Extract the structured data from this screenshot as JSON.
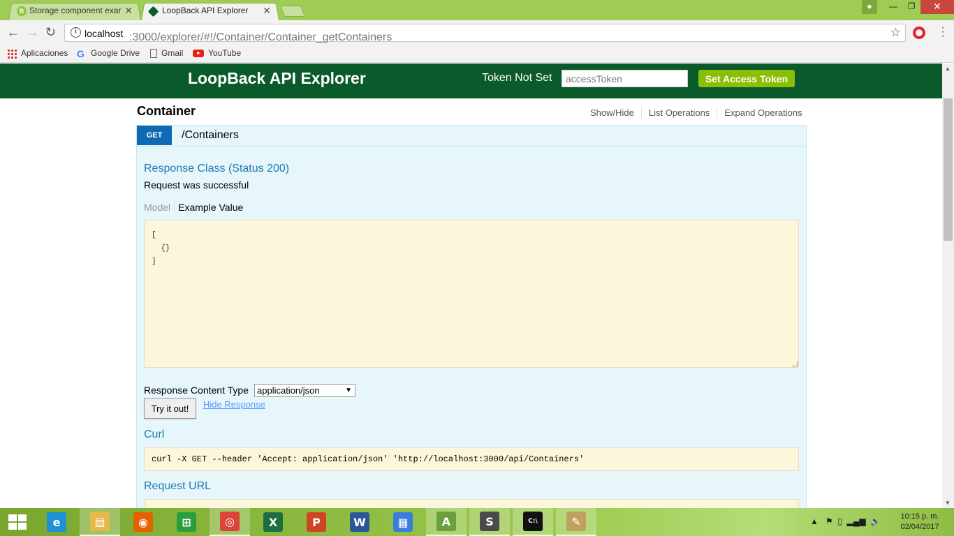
{
  "browser": {
    "tabs": [
      {
        "label": "Storage component exar",
        "icon": "bootstrap-icon",
        "active": false
      },
      {
        "label": "LoopBack API Explorer",
        "icon": "loopback-icon",
        "active": true
      }
    ],
    "url_host": "localhost",
    "url_path": ":3000/explorer/#!/Container/Container_getContainers",
    "bookmarks": [
      {
        "label": "Aplicaciones",
        "icon": "apps-grid-icon"
      },
      {
        "label": "Google Drive",
        "icon": "google-icon"
      },
      {
        "label": "Gmail",
        "icon": "page-icon"
      },
      {
        "label": "YouTube",
        "icon": "youtube-icon"
      }
    ]
  },
  "header": {
    "title": "LoopBack API Explorer",
    "token_status": "Token Not Set",
    "token_placeholder": "accessToken",
    "set_token_label": "Set Access Token"
  },
  "resource": {
    "title": "Container",
    "links": [
      "Show/Hide",
      "List Operations",
      "Expand Operations"
    ]
  },
  "operation": {
    "method": "GET",
    "path": "/Containers",
    "response_class_title": "Response Class (Status 200)",
    "response_message": "Request was successful",
    "model_tab": "Model",
    "example_tab": "Example Value",
    "example_value": "[\n  {}\n]",
    "content_type_label": "Response Content Type",
    "content_type_value": "application/json",
    "try_label": "Try it out!",
    "hide_response_label": "Hide Response",
    "curl_title": "Curl",
    "curl_command": "curl -X GET --header 'Accept: application/json' 'http://localhost:3000/api/Containers'",
    "request_url_title": "Request URL"
  },
  "taskbar": {
    "apps": [
      {
        "name": "internet-explorer",
        "glyph": "e",
        "color": "#1e90d6"
      },
      {
        "name": "file-explorer",
        "glyph": "▤",
        "color": "#e7b84a"
      },
      {
        "name": "firefox",
        "glyph": "◉",
        "color": "#e66000"
      },
      {
        "name": "store",
        "glyph": "⊞",
        "color": "#2a9d3f"
      },
      {
        "name": "chrome",
        "glyph": "◎",
        "color": "#db4437"
      },
      {
        "name": "excel",
        "glyph": "X",
        "color": "#1d6f42"
      },
      {
        "name": "powerpoint",
        "glyph": "P",
        "color": "#d04423"
      },
      {
        "name": "word",
        "glyph": "W",
        "color": "#2b579a"
      },
      {
        "name": "control-panel",
        "glyph": "▦",
        "color": "#3b7ddd"
      },
      {
        "name": "android-studio",
        "glyph": "A",
        "color": "#6a9f3c"
      },
      {
        "name": "sublime-text",
        "glyph": "S",
        "color": "#4a4a4a"
      },
      {
        "name": "command-prompt",
        "glyph": "C:\\",
        "color": "#111111"
      },
      {
        "name": "paint",
        "glyph": "✎",
        "color": "#c0a060"
      }
    ],
    "time": "10:15 p. m.",
    "date": "02/04/2017"
  }
}
